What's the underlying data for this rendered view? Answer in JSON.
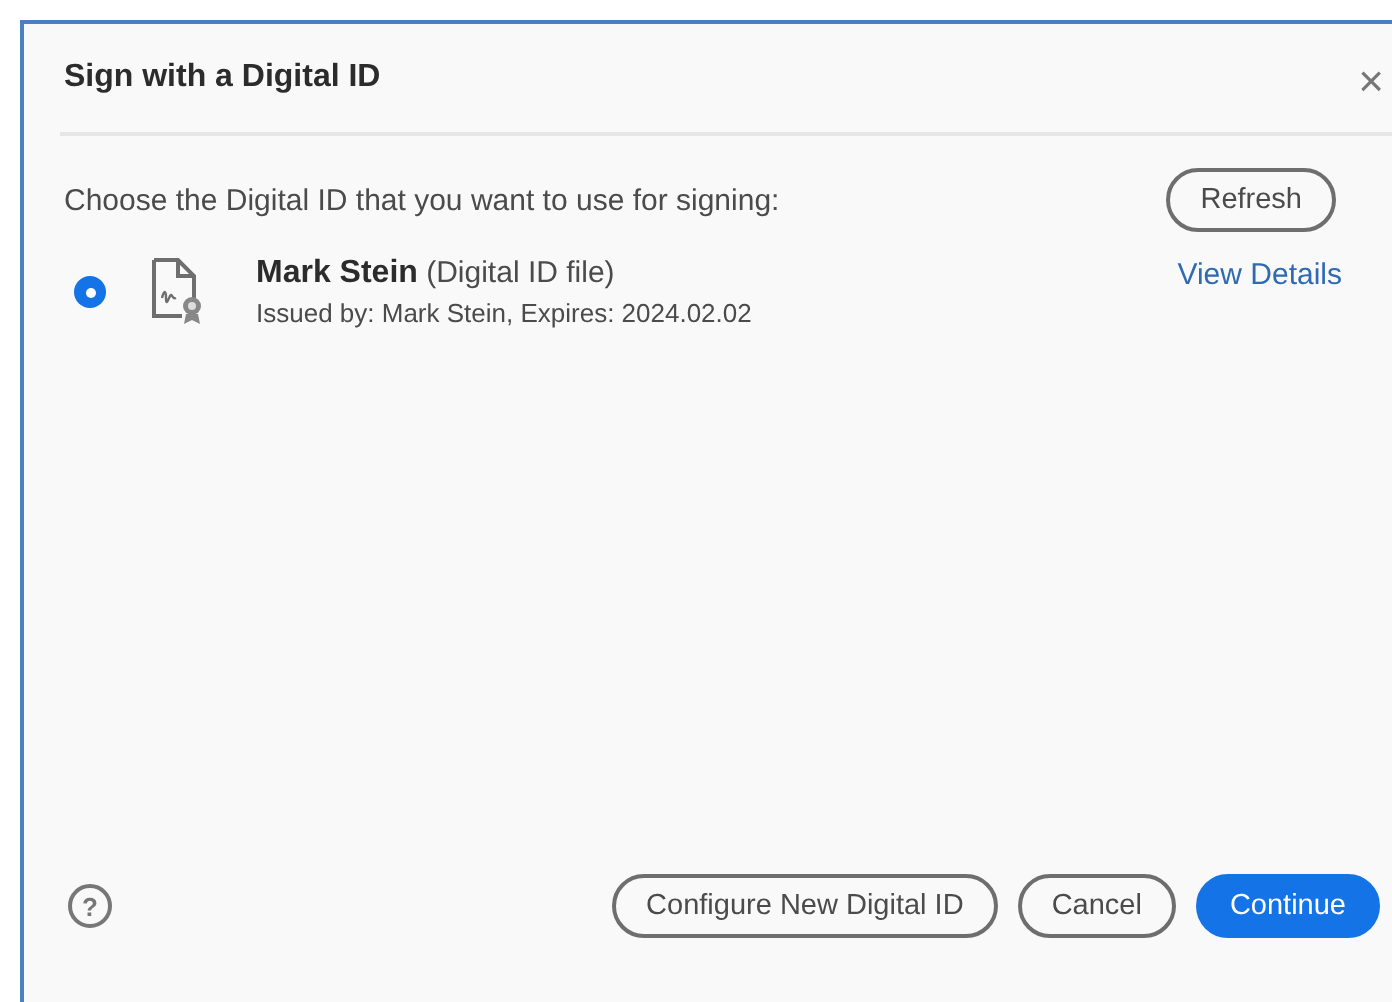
{
  "dialog": {
    "title": "Sign with a Digital ID",
    "close": "×"
  },
  "prompt": "Choose the Digital ID that you want to use for signing:",
  "refresh_button": "Refresh",
  "ids": [
    {
      "name": "Mark Stein",
      "type": "(Digital ID file)",
      "details": "Issued by: Mark Stein, Expires: 2024.02.02",
      "link": "View Details",
      "selected": true
    }
  ],
  "help": "?",
  "buttons": [
    {
      "label": "Configure New Digital ID",
      "kind": "secondary"
    },
    {
      "label": "Cancel",
      "kind": "secondary"
    },
    {
      "label": "Continue",
      "kind": "primary"
    }
  ]
}
